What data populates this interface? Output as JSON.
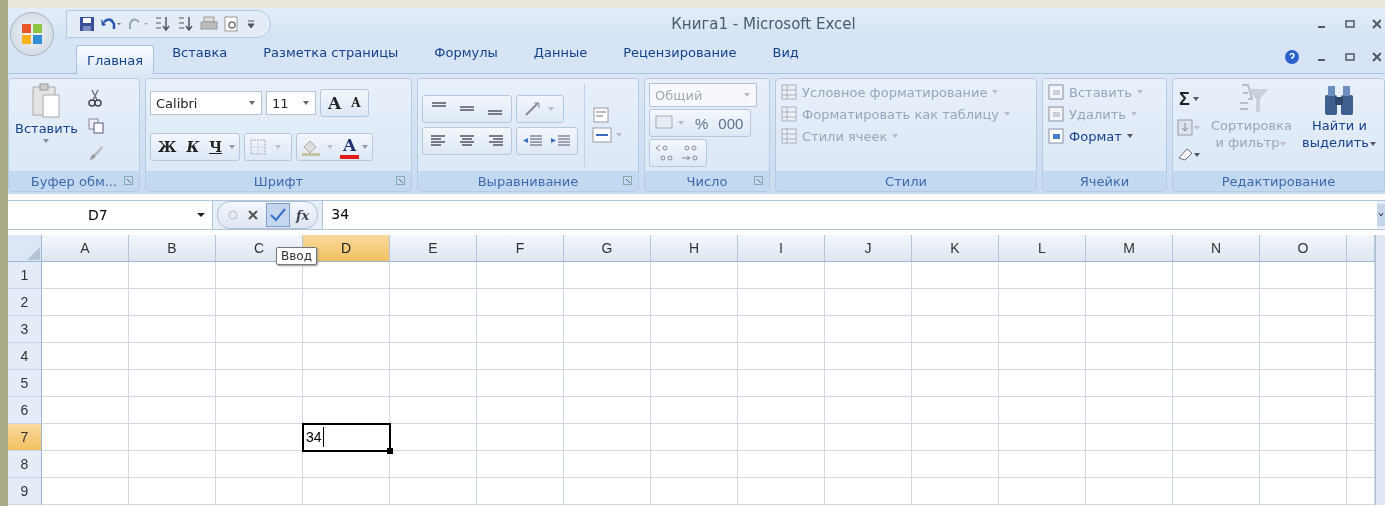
{
  "window": {
    "title": "Книга1 - Microsoft Excel"
  },
  "tabs": [
    {
      "label": "Главная",
      "selected": true
    },
    {
      "label": "Вставка",
      "selected": false
    },
    {
      "label": "Разметка страницы",
      "selected": false
    },
    {
      "label": "Формулы",
      "selected": false
    },
    {
      "label": "Данные",
      "selected": false
    },
    {
      "label": "Рецензирование",
      "selected": false
    },
    {
      "label": "Вид",
      "selected": false
    }
  ],
  "clipboard": {
    "title": "Буфер обм...",
    "paste": "Вставить"
  },
  "font": {
    "title": "Шрифт",
    "family": "Calibri",
    "size": "11",
    "grow": "A",
    "shrink": "A",
    "bold": "Ж",
    "italic": "К",
    "underline": "Ч",
    "color_letter": "A"
  },
  "alignment": {
    "title": "Выравнивание"
  },
  "number": {
    "title": "Число",
    "format": "Общий",
    "percent": "%",
    "thousands": "000"
  },
  "styles": {
    "title": "Стили",
    "items": [
      {
        "label": "Условное форматирование",
        "disabled": true
      },
      {
        "label": "Форматировать как таблицу",
        "disabled": true
      },
      {
        "label": "Стили ячеек",
        "disabled": true
      }
    ]
  },
  "cells": {
    "title": "Ячейки",
    "items": [
      {
        "label": "Вставить",
        "disabled": true
      },
      {
        "label": "Удалить",
        "disabled": true
      },
      {
        "label": "Формат",
        "disabled": false
      }
    ]
  },
  "editing": {
    "title": "Редактирование",
    "sum": "Σ",
    "buttons": [
      {
        "lines": [
          "Сортировка",
          "и фильтр"
        ],
        "disabled": true
      },
      {
        "lines": [
          "Найти и",
          "выделить"
        ],
        "disabled": false
      }
    ]
  },
  "formula_bar": {
    "name_box": "D7",
    "fx": "fx",
    "value": "34",
    "tooltip": "Ввод"
  },
  "sheet": {
    "columns": [
      {
        "label": "A",
        "selected": false
      },
      {
        "label": "B",
        "selected": false
      },
      {
        "label": "C",
        "selected": false
      },
      {
        "label": "D",
        "selected": true
      },
      {
        "label": "E",
        "selected": false
      },
      {
        "label": "F",
        "selected": false
      },
      {
        "label": "G",
        "selected": false
      },
      {
        "label": "H",
        "selected": false
      },
      {
        "label": "I",
        "selected": false
      },
      {
        "label": "J",
        "selected": false
      },
      {
        "label": "K",
        "selected": false
      },
      {
        "label": "L",
        "selected": false
      },
      {
        "label": "M",
        "selected": false
      },
      {
        "label": "N",
        "selected": false
      },
      {
        "label": "O",
        "selected": false
      }
    ],
    "rows": [
      {
        "label": "1",
        "selected": false
      },
      {
        "label": "2",
        "selected": false
      },
      {
        "label": "3",
        "selected": false
      },
      {
        "label": "4",
        "selected": false
      },
      {
        "label": "5",
        "selected": false
      },
      {
        "label": "6",
        "selected": false
      },
      {
        "label": "7",
        "selected": true,
        "value": "34"
      },
      {
        "label": "8",
        "selected": false
      },
      {
        "label": "9",
        "selected": false
      }
    ]
  }
}
